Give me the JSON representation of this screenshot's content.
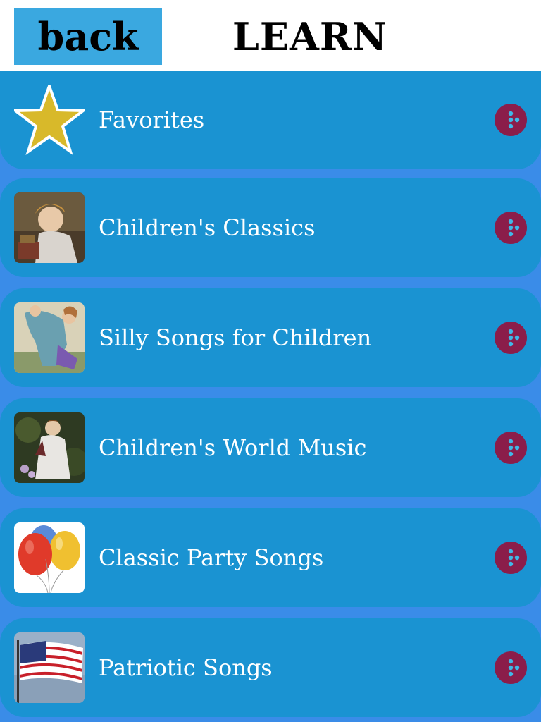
{
  "header": {
    "back_label": "back",
    "title": "LEARN"
  },
  "colors": {
    "accent_blue": "#3aa8e0",
    "row_blue": "#1a93d2",
    "background": "#3a8ce8",
    "dots_button": "#8b1d4a",
    "dots": "#3fb8e8",
    "star": "#d8b92a"
  },
  "categories": [
    {
      "label": "Favorites",
      "icon": "star-icon"
    },
    {
      "label": "Children's Classics",
      "icon": "girl-painting-thumbnail"
    },
    {
      "label": "Silly Songs for Children",
      "icon": "children-painting-thumbnail"
    },
    {
      "label": "Children's World Music",
      "icon": "girl-garden-painting-thumbnail"
    },
    {
      "label": "Classic Party Songs",
      "icon": "balloons-thumbnail"
    },
    {
      "label": "Patriotic Songs",
      "icon": "american-flag-thumbnail"
    }
  ]
}
